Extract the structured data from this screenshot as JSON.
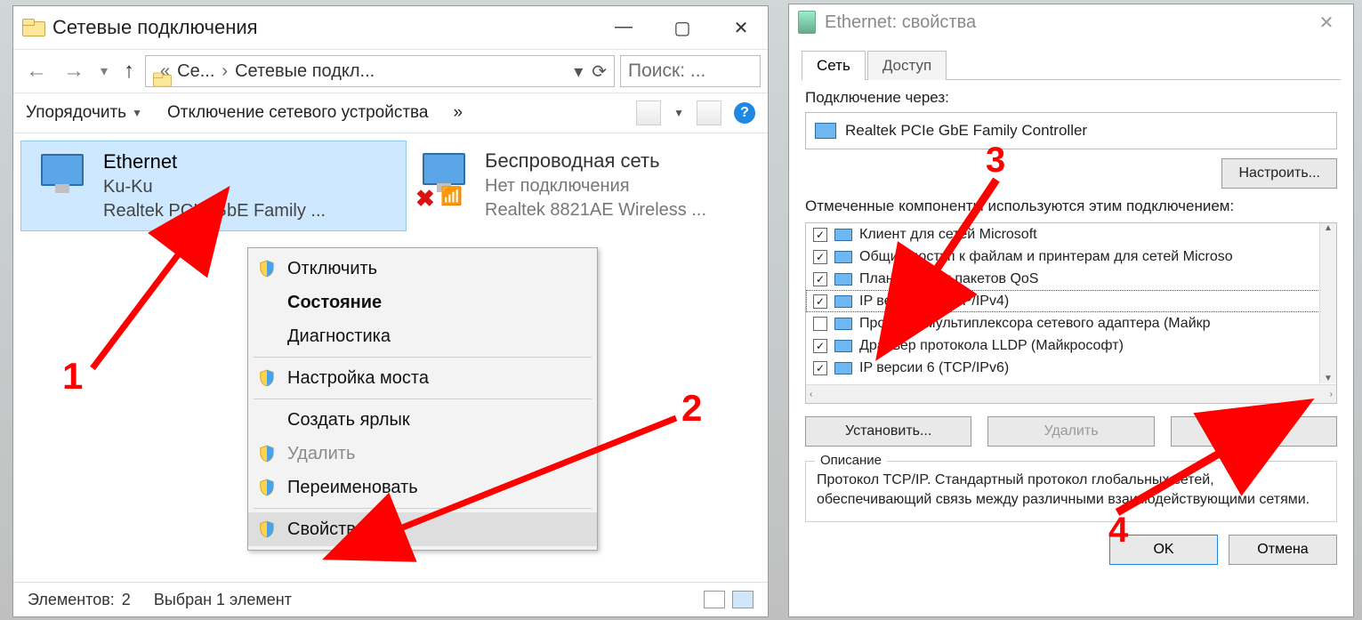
{
  "w1": {
    "title": "Сетевые подключения",
    "breadcrumb": {
      "root": "Се...",
      "current": "Сетевые подкл..."
    },
    "search_placeholder": "Поиск: ...",
    "toolbar": {
      "sort": "Упорядочить",
      "disable": "Отключение сетевого устройства",
      "more": "»"
    },
    "connections": [
      {
        "name": "Ethernet",
        "status": "Ku-Ku",
        "device": "Realtek PCIe GbE Family ..."
      },
      {
        "name": "Беспроводная сеть",
        "status": "Нет подключения",
        "device": "Realtek 8821AE Wireless ..."
      }
    ],
    "status": {
      "count_label": "Элементов:",
      "count": "2",
      "selected": "Выбран 1 элемент"
    }
  },
  "context_menu": {
    "items": [
      {
        "label": "Отключить",
        "shield": true
      },
      {
        "label": "Состояние",
        "bold": true
      },
      {
        "label": "Диагностика"
      },
      {
        "sep": true
      },
      {
        "label": "Настройка моста",
        "shield": true
      },
      {
        "sep": true
      },
      {
        "label": "Создать ярлык"
      },
      {
        "label": "Удалить",
        "shield": true,
        "disabled": true
      },
      {
        "label": "Переименовать",
        "shield": true
      },
      {
        "sep": true
      },
      {
        "label": "Свойства",
        "shield": true,
        "selected": true
      }
    ]
  },
  "w2": {
    "title": "Ethernet: свойства",
    "tabs": {
      "active": "Сеть",
      "other": "Доступ"
    },
    "connect_via_label": "Подключение через:",
    "adapter": "Realtek PCIe GbE Family Controller",
    "configure": "Настроить...",
    "components_label": "Отмеченные компоненты используются этим подключением:",
    "components": [
      {
        "checked": true,
        "label": "Клиент для сетей Microsoft"
      },
      {
        "checked": true,
        "label": "Общий доступ к файлам и принтерам для сетей Microso"
      },
      {
        "checked": true,
        "label": "Планировщик пакетов QoS"
      },
      {
        "checked": true,
        "label": "IP версии 4 (TCP/IPv4)",
        "selected": true
      },
      {
        "checked": false,
        "label": "Протокол мультиплексора сетевого адаптера (Майкр"
      },
      {
        "checked": true,
        "label": "Драйвер протокола LLDP (Майкрософт)"
      },
      {
        "checked": true,
        "label": "IP версии 6 (TCP/IPv6)"
      }
    ],
    "buttons": {
      "install": "Установить...",
      "remove": "Удалить",
      "props": "Свойства"
    },
    "description": {
      "legend": "Описание",
      "text": "Протокол TCP/IP. Стандартный протокол глобальных сетей, обеспечивающий связь между различными взаимодействующими сетями."
    },
    "ok": "OK",
    "cancel": "Отмена"
  },
  "annotations": {
    "n1": "1",
    "n2": "2",
    "n3": "3",
    "n4": "4"
  }
}
